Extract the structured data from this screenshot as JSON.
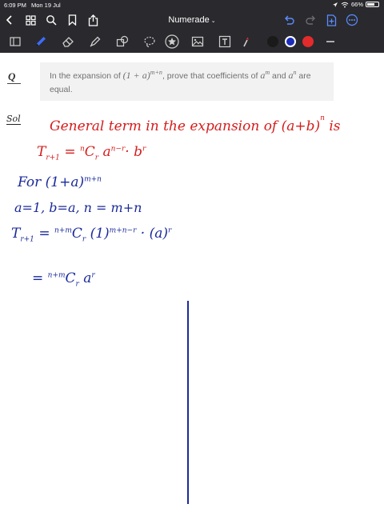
{
  "status_bar": {
    "time": "6:09 PM",
    "date": "Mon 19 Jul",
    "battery": "66%",
    "battery_level": 0.66
  },
  "nav": {
    "title": "Numerade",
    "chevron": "⌄",
    "left_icons": [
      "chevron-left-icon",
      "grid-icon",
      "search-icon",
      "bookmark-icon",
      "share-icon"
    ],
    "right_icons": [
      "undo-icon",
      "redo-icon",
      "add-page-icon",
      "more-icon"
    ]
  },
  "toolbar": {
    "tools": [
      "sidebar-icon",
      "pen-icon",
      "eraser-icon",
      "highlighter-icon",
      "shapes-icon",
      "lasso-icon",
      "sticker-icon",
      "image-icon",
      "text-icon",
      "laser-icon"
    ],
    "colors": [
      "#1a1a1a",
      "#1c2db8",
      "#e32b2b"
    ],
    "selected_color": "#1c2db8"
  },
  "question": {
    "marker": "Q",
    "text_1": "In the expansion of ",
    "expr_base": "(1 + a)",
    "expr_exp": "m+n",
    "text_2": ", prove that coefficients of ",
    "a1": "a",
    "a1_exp": "m",
    "text_3": " and ",
    "a2": "a",
    "a2_exp": "n",
    "text_4": " are equal."
  },
  "solution": {
    "label": "Sol",
    "line1_text": "General term in the expansion of (a+b)",
    "line1_exp": "n",
    "line1_end": "is",
    "line2_T": "T",
    "line2_sub": "r+1",
    "line2_eq": "= ",
    "line2_pre": "n",
    "line2_C": "C",
    "line2_Csub": "r",
    "line2_a": " a",
    "line2_aexp": "n−r",
    "line2_dot": "· b",
    "line2_bexp": "r",
    "line3_text": "For (1+a)",
    "line3_exp": "m+n",
    "line4_text": "a=1,  b=a,    n = m+n",
    "line5_T": "T",
    "line5_sub": "r+1",
    "line5_eq": "= ",
    "line5_pre": "n+m",
    "line5_C": "C",
    "line5_Csub": "r",
    "line5_one": " (1)",
    "line5_oneexp": "m+n−r",
    "line5_a": " · (a)",
    "line5_aexp": "r",
    "line6_eq": "=",
    "line6_pre": "n+m",
    "line6_C": "C",
    "line6_Csub": "r",
    "line6_a": " a",
    "line6_aexp": "r"
  }
}
